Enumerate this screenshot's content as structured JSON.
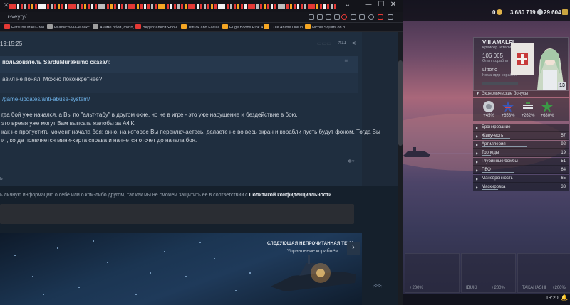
{
  "browser": {
    "url": "...r-veyry/",
    "bookmarks": [
      {
        "label": "Hatsune Miku - Mo...",
        "color": "#e53935"
      },
      {
        "label": "Реалистичные секс...",
        "color": "#9e9e9e"
      },
      {
        "label": "Аниме обои, фото,...",
        "color": "#9e9e9e"
      },
      {
        "label": "Видеозаписи Япон...",
        "color": "#e53935"
      },
      {
        "label": "Titfuck and Facial...",
        "color": "#f5a623"
      },
      {
        "label": "Huge Boobs Pink A...",
        "color": "#f5a623"
      },
      {
        "label": "Cute Anime Doll in...",
        "color": "#f5a623"
      },
      {
        "label": "Nicole Squirts on h...",
        "color": "#f5a623"
      }
    ]
  },
  "post": {
    "time": "19:15:25",
    "number": "#11",
    "quote_header": "пользователь SarduMurakumo сказал:",
    "quote_text": "авил не понял. Можно поконкретнее?",
    "link": "/game-updates/anti-abuse-system/",
    "paragraphs": [
      "гда бой уже начался, а Вы по \"альт-табу\" в другом окне, но не  в игре - это уже нарушение и бездействие в бою.",
      " это время  уже могут Вам  выпсать жалобы за АФК.",
      " как не пропустить момент начала боя: окно, на которое Вы переключаетесь, делаете не во весь экран и корабли пусть будут фоном. Тогда Вы",
      "ит, когда появляется мини-карта справа и начнется отсчет до начала боя."
    ]
  },
  "editor": {
    "privacy_text": "ь личную информацию о себе или о ком-либо другом, так как мы не сможем защитить её в соответствии с ",
    "privacy_link": "Политикой конфиденциальности",
    "privacy_end": "."
  },
  "next_topic": {
    "label": "СЛЕДУЮЩАЯ НЕПРОЧИТАННАЯ ТЕМА",
    "title": "Управление кораблём"
  },
  "game": {
    "resources": {
      "doubloons": "0",
      "credits": "3 680 719",
      "free_xp": "29 604"
    },
    "ship": {
      "name": "VIII AMALFI",
      "subtitle": "Крейсер. Италия",
      "xp": "106 065",
      "xp_label": "Опыт корабля",
      "commander": "Littorio",
      "commander_label": "Командир корабля",
      "level": "13"
    },
    "economic_title": "Экономические бонусы",
    "economic": [
      {
        "value": "+45%",
        "icon": "signal-flag-icon"
      },
      {
        "value": "+653%",
        "icon": "star-icon"
      },
      {
        "value": "+262%",
        "icon": "stripes-icon"
      },
      {
        "value": "+680%",
        "icon": "green-star-icon"
      }
    ],
    "stats": [
      {
        "name": "Бронирование",
        "value": "",
        "fill": 0
      },
      {
        "name": "Живучесть",
        "value": "57",
        "fill": 0.57
      },
      {
        "name": "Артиллерия",
        "value": "92",
        "fill": 0.92
      },
      {
        "name": "Торпеды",
        "value": "19",
        "fill": 0.19
      },
      {
        "name": "Глубинные бомбы",
        "value": "51",
        "fill": 0.51
      },
      {
        "name": "ПВО",
        "value": "64",
        "fill": 0.64
      },
      {
        "name": "Маневренность",
        "value": "65",
        "fill": 0.65
      },
      {
        "name": "Маскировка",
        "value": "33",
        "fill": 0.33
      }
    ],
    "slots": [
      "+200%",
      "IBUKI",
      "+200%",
      "TAKAHASHI",
      "+200%"
    ],
    "clock": "19:20"
  }
}
